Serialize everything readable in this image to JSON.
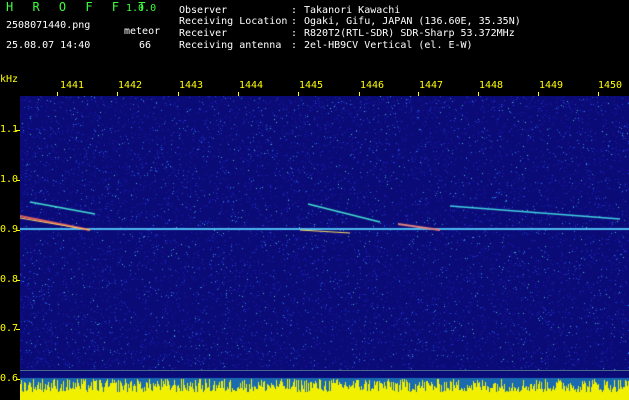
{
  "header": {
    "app_name": "H R O F F T",
    "version": "1.0.0",
    "filename": "2508071440.png",
    "timestamp": "25.08.07 14:40",
    "meteor_label": "meteor",
    "meteor_count": "66",
    "info": [
      {
        "key": "Observer",
        "sep": ":",
        "value": "Takanori Kawachi"
      },
      {
        "key": "Receiving Location",
        "sep": ":",
        "value": "Ogaki, Gifu, JAPAN (136.60E, 35.35N)"
      },
      {
        "key": "Receiver",
        "sep": ":",
        "value": "R820T2(RTL-SDR) SDR-Sharp 53.372MHz"
      },
      {
        "key": "Receiving antenna",
        "sep": ":",
        "value": "2el-HB9CV Vertical (el. E-W)"
      }
    ]
  },
  "axes": {
    "y_unit": "kHz",
    "y_ticks": [
      "1.1",
      "1.0",
      "0.9",
      "0.8",
      "0.7",
      "0.6"
    ],
    "x_ticks": [
      "1441",
      "1442",
      "1443",
      "1444",
      "1445",
      "1446",
      "1447",
      "1448",
      "1449",
      "1450"
    ]
  },
  "colors": {
    "text": "#ffffff",
    "accent": "#ffff00",
    "title": "#3cff3c",
    "background": "#0a0a7a"
  }
}
